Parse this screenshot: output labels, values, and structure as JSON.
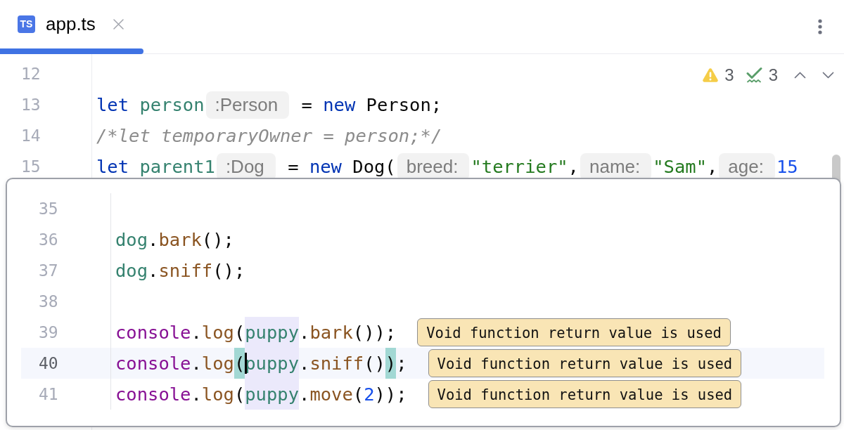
{
  "tabs": [
    {
      "label": "app.ts",
      "badge": "TS",
      "selected": true
    }
  ],
  "editor": {
    "problems": [
      {
        "kind": "warning",
        "count": "3"
      },
      {
        "kind": "check",
        "count": "3"
      }
    ],
    "lines": [
      {
        "number": "12"
      },
      {
        "number": "13",
        "tokens": [
          {
            "kind": "keyword",
            "text": "let"
          },
          {
            "kind": "variable",
            "text": " person"
          },
          {
            "kind": "hint",
            "text": ":Person"
          },
          {
            "kind": "plain",
            "text": " = "
          },
          {
            "kind": "keyword",
            "text": "new"
          },
          {
            "kind": "plain",
            "text": " Person;"
          }
        ]
      },
      {
        "number": "14",
        "tokens": [
          {
            "kind": "comment",
            "text": "/*let temporaryOwner = person;*/"
          }
        ]
      },
      {
        "number": "15",
        "tokens": [
          {
            "kind": "keyword",
            "text": "let"
          },
          {
            "kind": "variable",
            "text": " parent1"
          },
          {
            "kind": "hint",
            "text": ":Dog"
          },
          {
            "kind": "plain",
            "text": " = "
          },
          {
            "kind": "keyword",
            "text": "new"
          },
          {
            "kind": "plain",
            "text": " Dog("
          },
          {
            "kind": "hint",
            "text": "breed:"
          },
          {
            "kind": "string",
            "text": "\"terrier\""
          },
          {
            "kind": "plain",
            "text": ","
          },
          {
            "kind": "hint",
            "text": "name:"
          },
          {
            "kind": "string",
            "text": "\"Sam\""
          },
          {
            "kind": "plain",
            "text": ","
          },
          {
            "kind": "hint",
            "text": "age:"
          },
          {
            "kind": "number",
            "text": "15"
          }
        ]
      }
    ]
  },
  "popup": {
    "lines": [
      {
        "number": "35",
        "current": false
      },
      {
        "number": "36",
        "current": false,
        "tokens": [
          {
            "kind": "variable",
            "text": "dog"
          },
          {
            "kind": "plain",
            "text": "."
          },
          {
            "kind": "method",
            "text": "bark"
          },
          {
            "kind": "plain",
            "text": "();"
          }
        ]
      },
      {
        "number": "37",
        "current": false,
        "tokens": [
          {
            "kind": "variable",
            "text": "dog"
          },
          {
            "kind": "plain",
            "text": "."
          },
          {
            "kind": "method",
            "text": "sniff"
          },
          {
            "kind": "plain",
            "text": "();"
          }
        ]
      },
      {
        "number": "38",
        "current": false
      },
      {
        "number": "39",
        "current": false,
        "tokens": [
          {
            "kind": "global",
            "text": "console"
          },
          {
            "kind": "plain",
            "text": "."
          },
          {
            "kind": "method",
            "text": "log"
          },
          {
            "kind": "plain",
            "text": "("
          },
          {
            "kind": "usage",
            "text": "puppy"
          },
          {
            "kind": "plain",
            "text": "."
          },
          {
            "kind": "method",
            "text": "bark"
          },
          {
            "kind": "plain",
            "text": "());"
          }
        ],
        "annotation": "Void function return value is used"
      },
      {
        "number": "40",
        "current": true,
        "tokens": [
          {
            "kind": "global",
            "text": "console"
          },
          {
            "kind": "plain",
            "text": "."
          },
          {
            "kind": "method",
            "text": "log"
          },
          {
            "kind": "brace",
            "text": "("
          },
          {
            "kind": "caret"
          },
          {
            "kind": "usage",
            "text": "puppy"
          },
          {
            "kind": "plain",
            "text": "."
          },
          {
            "kind": "method",
            "text": "sniff"
          },
          {
            "kind": "plain",
            "text": "()"
          },
          {
            "kind": "brace",
            "text": ")"
          },
          {
            "kind": "plain",
            "text": ";"
          }
        ],
        "annotation": "Void function return value is used"
      },
      {
        "number": "41",
        "current": false,
        "tokens": [
          {
            "kind": "global",
            "text": "console"
          },
          {
            "kind": "plain",
            "text": "."
          },
          {
            "kind": "method",
            "text": "log"
          },
          {
            "kind": "plain",
            "text": "("
          },
          {
            "kind": "usage",
            "text": "puppy"
          },
          {
            "kind": "plain",
            "text": "."
          },
          {
            "kind": "method",
            "text": "move"
          },
          {
            "kind": "plain",
            "text": "("
          },
          {
            "kind": "number",
            "text": "2"
          },
          {
            "kind": "plain",
            "text": "));"
          }
        ],
        "annotation": "Void function return value is used"
      }
    ]
  }
}
